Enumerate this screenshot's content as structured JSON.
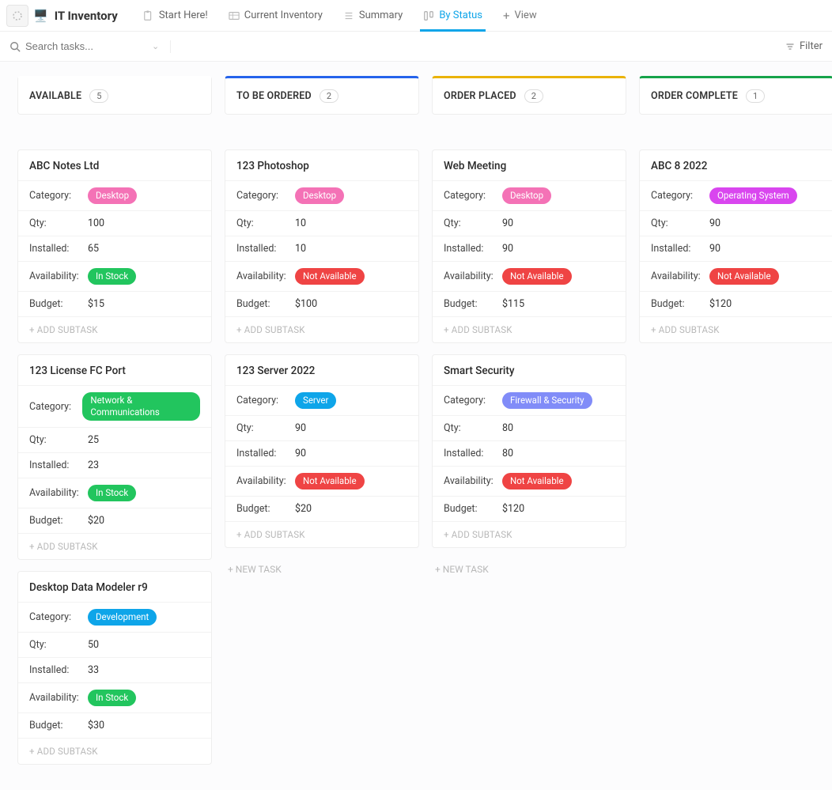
{
  "header": {
    "app_title": "IT Inventory",
    "tabs": [
      {
        "label": "Start Here!"
      },
      {
        "label": "Current Inventory"
      },
      {
        "label": "Summary"
      },
      {
        "label": "By Status",
        "active": true
      }
    ],
    "add_view_label": "View"
  },
  "toolbar": {
    "search_placeholder": "Search tasks...",
    "filter_label": "Filter"
  },
  "labels": {
    "category": "Category:",
    "qty": "Qty:",
    "installed": "Installed:",
    "availability": "Availability:",
    "budget": "Budget:",
    "add_subtask": "+ ADD SUBTASK",
    "new_task": "+ NEW TASK"
  },
  "pill_colors": {
    "Desktop": "#f472b6",
    "Network & Communications": "#22c55e",
    "Development": "#0ea5e9",
    "Server": "#0ea5e9",
    "Firewall & Security": "#818cf8",
    "Operating System": "#d946ef",
    "In Stock": "#22c55e",
    "Not Available": "#ef4444"
  },
  "columns": [
    {
      "name": "AVAILABLE",
      "count": "5",
      "accent": "#ffffff",
      "cards": [
        {
          "title": "ABC Notes Ltd",
          "category": "Desktop",
          "qty": "100",
          "installed": "65",
          "availability": "In Stock",
          "budget": "$15"
        },
        {
          "title": "123 License FC Port",
          "category": "Network & Communications",
          "qty": "25",
          "installed": "23",
          "availability": "In Stock",
          "budget": "$20"
        },
        {
          "title": "Desktop Data Modeler r9",
          "category": "Development",
          "qty": "50",
          "installed": "33",
          "availability": "In Stock",
          "budget": "$30"
        }
      ]
    },
    {
      "name": "TO BE ORDERED",
      "count": "2",
      "accent": "#2563eb",
      "cards": [
        {
          "title": "123 Photoshop",
          "category": "Desktop",
          "qty": "10",
          "installed": "10",
          "availability": "Not Available",
          "budget": "$100"
        },
        {
          "title": "123 Server 2022",
          "category": "Server",
          "qty": "90",
          "installed": "90",
          "availability": "Not Available",
          "budget": "$20"
        }
      ],
      "show_new_task": true
    },
    {
      "name": "ORDER PLACED",
      "count": "2",
      "accent": "#eab308",
      "cards": [
        {
          "title": "Web Meeting",
          "category": "Desktop",
          "qty": "90",
          "installed": "90",
          "availability": "Not Available",
          "budget": "$115"
        },
        {
          "title": "Smart Security",
          "category": "Firewall & Security",
          "qty": "80",
          "installed": "80",
          "availability": "Not Available",
          "budget": "$120"
        }
      ],
      "show_new_task": true
    },
    {
      "name": "ORDER COMPLETE",
      "count": "1",
      "accent": "#16a34a",
      "cards": [
        {
          "title": "ABC 8 2022",
          "category": "Operating System",
          "qty": "90",
          "installed": "90",
          "availability": "Not Available",
          "budget": "$120"
        }
      ]
    }
  ]
}
